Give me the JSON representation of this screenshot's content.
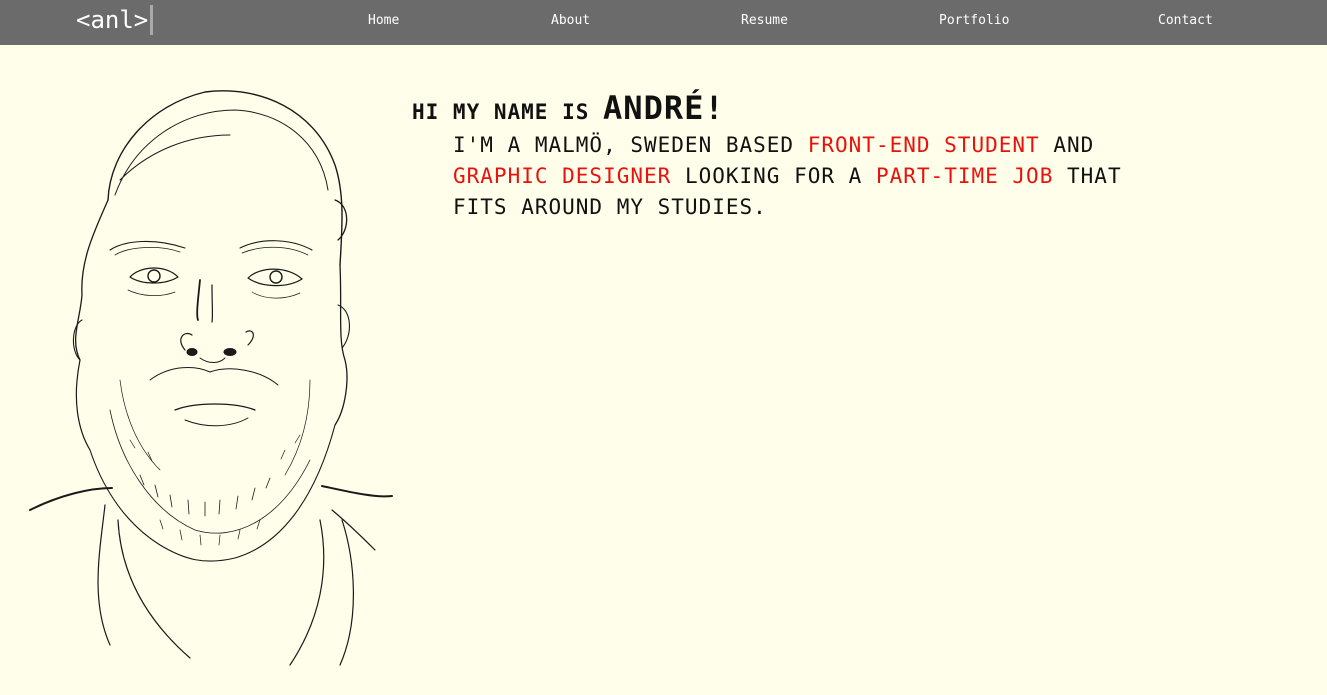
{
  "nav": {
    "logo": "<anl>",
    "links": [
      "Home",
      "About",
      "Resume",
      "Portfolio",
      "Contact"
    ]
  },
  "hero": {
    "greeting": "HI MY NAME IS",
    "name": "ANDRÉ!",
    "bio": {
      "part1": "I'M A MALMÖ, SWEDEN BASED",
      "highlight1": "FRONT-END STUDENT",
      "part2": "AND",
      "highlight2": "GRAPHIC DESIGNER",
      "part3": "LOOKING FOR A",
      "highlight3": "PART-TIME JOB",
      "part4": "THAT FITS AROUND MY STUDIES."
    }
  },
  "colors": {
    "background": "#fefeea",
    "navbar": "#6b6b6b",
    "accent": "#e8120c",
    "text": "#111111"
  }
}
